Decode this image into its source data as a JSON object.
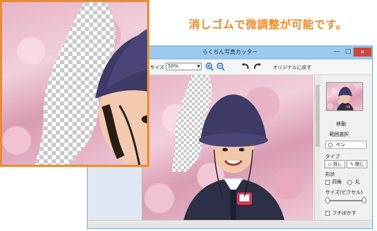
{
  "headline": "消しゴムで微調整が可能です。",
  "window": {
    "title": "らくちん写真カッター",
    "minimize": "—",
    "maximize": "□",
    "close": "✕"
  },
  "toolbar": {
    "size_label": "サイズ",
    "zoom_value": "50%",
    "reset_label": "オリジナルに戻す"
  },
  "panel": {
    "move_label": "移動",
    "range_label": "範囲選択",
    "pen_label": "ペン",
    "type_label": "タイプ",
    "erase_label": "消し",
    "close_shape_label": "閉じ",
    "shape_label": "形状",
    "square_label": "四角",
    "circle_label": "丸",
    "brush_size_label": "サイズ(ピクセル)",
    "blur_edge_label": "フチ",
    "blur_edge_label2": "ぼかす"
  },
  "icons": {
    "zoom_in": "zoom-in-icon",
    "zoom_out": "zoom-out-icon",
    "undo": "undo-icon",
    "redo": "redo-icon"
  },
  "colors": {
    "accent": "#f08a24",
    "title_bar": "#9cc9ee",
    "hat": "#3e3a66",
    "close": "#c8483f"
  }
}
